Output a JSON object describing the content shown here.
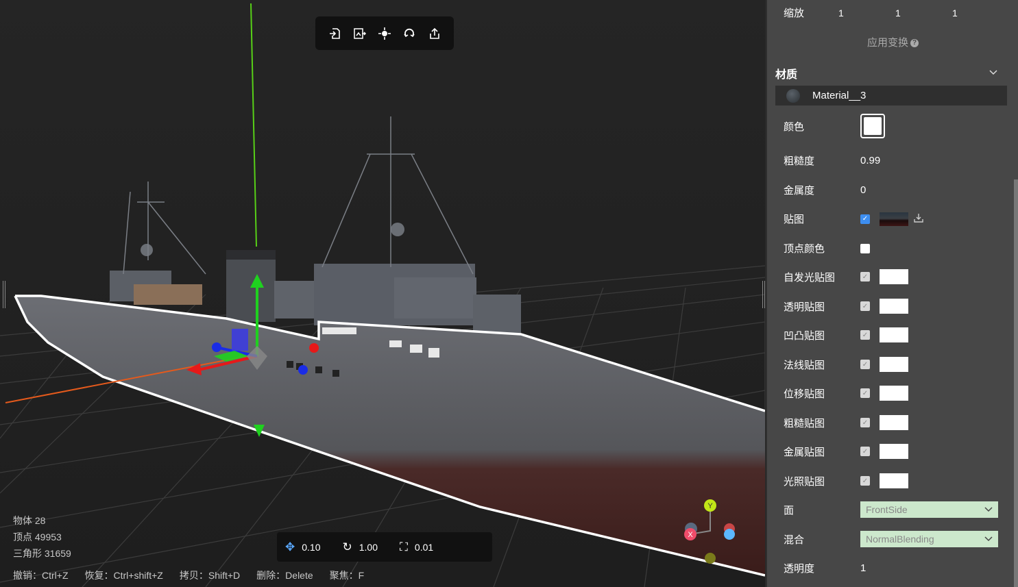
{
  "toolbar": {
    "icons": [
      "import-icon",
      "export-scene-icon",
      "focus-icon",
      "refresh-icon",
      "share-icon"
    ]
  },
  "stats": {
    "objects": "物体 28",
    "vertices": "顶点 49953",
    "triangles": "三角形 31659"
  },
  "shortcuts": [
    "撤销：Ctrl+Z",
    "恢复：Ctrl+shift+Z",
    "拷贝：Shift+D",
    "删除：Delete",
    "聚焦：F"
  ],
  "transform": {
    "translate": "0.10",
    "rotate": "1.00",
    "scale": "0.01"
  },
  "axis_gizmo": {
    "y": "Y",
    "x": "X"
  },
  "panel": {
    "scale_label": "缩放",
    "scale_values": [
      "1",
      "1",
      "1"
    ],
    "apply_transform": "应用变换",
    "help": "?",
    "material_section": "材质",
    "material_name": "Material__3",
    "color_label": "颜色",
    "roughness_label": "粗糙度",
    "roughness_value": "0.99",
    "metalness_label": "金属度",
    "metalness_value": "0",
    "map_label": "贴图",
    "vertex_color_label": "顶点颜色",
    "maps": [
      "自发光贴图",
      "透明贴图",
      "凹凸贴图",
      "法线贴图",
      "位移贴图",
      "粗糙贴图",
      "金属贴图",
      "光照贴图"
    ],
    "side_label": "面",
    "side_value": "FrontSide",
    "blending_label": "混合",
    "blending_value": "NormalBlending",
    "opacity_label": "透明度",
    "opacity_value": "1"
  }
}
